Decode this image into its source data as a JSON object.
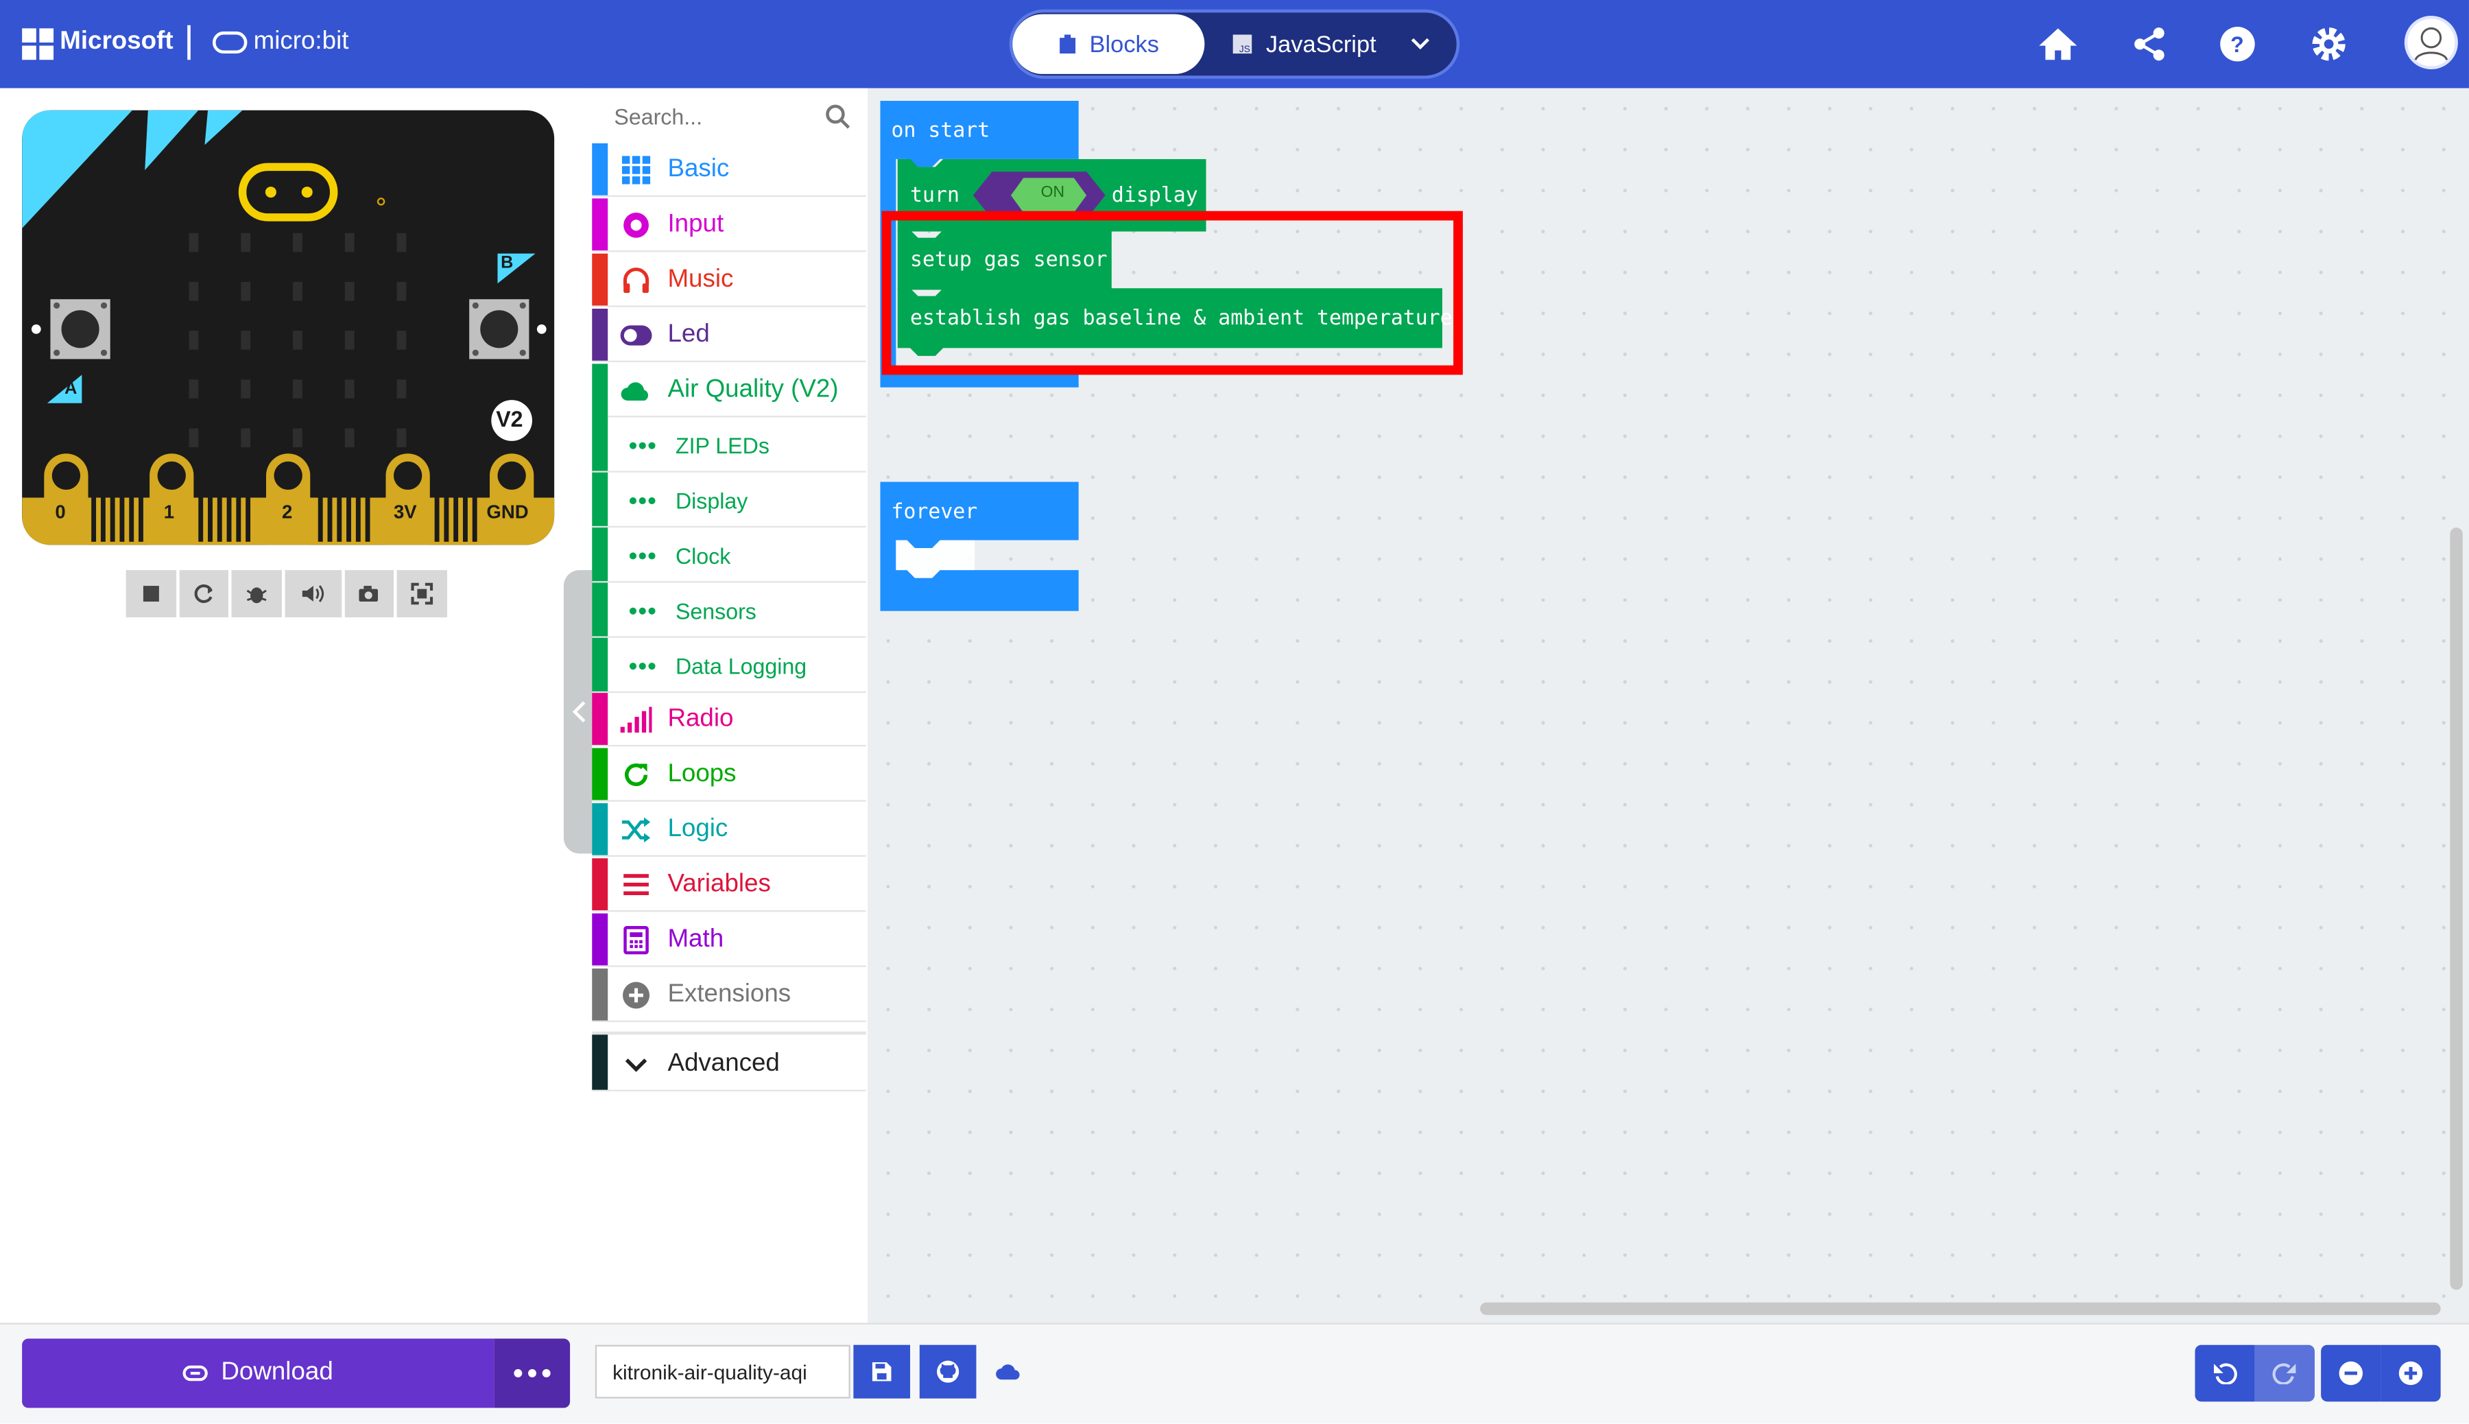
{
  "header": {
    "brand": "Microsoft",
    "product": "micro:bit",
    "tabs": {
      "blocks": "Blocks",
      "javascript": "JavaScript"
    }
  },
  "simulator": {
    "pins": [
      "0",
      "1",
      "2",
      "3V",
      "GND"
    ],
    "version": "V2",
    "button_a": "A",
    "button_b": "B"
  },
  "toolbox": {
    "search_placeholder": "Search...",
    "categories": [
      {
        "label": "Basic",
        "color": "#1e90ff"
      },
      {
        "label": "Input",
        "color": "#d400d4"
      },
      {
        "label": "Music",
        "color": "#e63022"
      },
      {
        "label": "Led",
        "color": "#5c2d91"
      },
      {
        "label": "Air Quality (V2)",
        "color": "#00a651"
      }
    ],
    "subcategories": [
      "ZIP LEDs",
      "Display",
      "Clock",
      "Sensors",
      "Data Logging"
    ],
    "categories2": [
      {
        "label": "Radio",
        "color": "#e3008c"
      },
      {
        "label": "Loops",
        "color": "#00aa00"
      },
      {
        "label": "Logic",
        "color": "#00a4a6"
      },
      {
        "label": "Variables",
        "color": "#dc143c"
      },
      {
        "label": "Math",
        "color": "#9400d3"
      },
      {
        "label": "Extensions",
        "color": "#757575"
      }
    ],
    "advanced": "Advanced"
  },
  "workspace": {
    "on_start": "on start",
    "turn": "turn",
    "on_toggle": "ON",
    "display": "display",
    "setup_gas": "setup gas sensor",
    "establish": "establish gas baseline & ambient temperature",
    "forever": "forever",
    "highlight_color": "#ff0000"
  },
  "footer": {
    "download": "Download",
    "project_name": "kitronik-air-quality-aqi"
  }
}
